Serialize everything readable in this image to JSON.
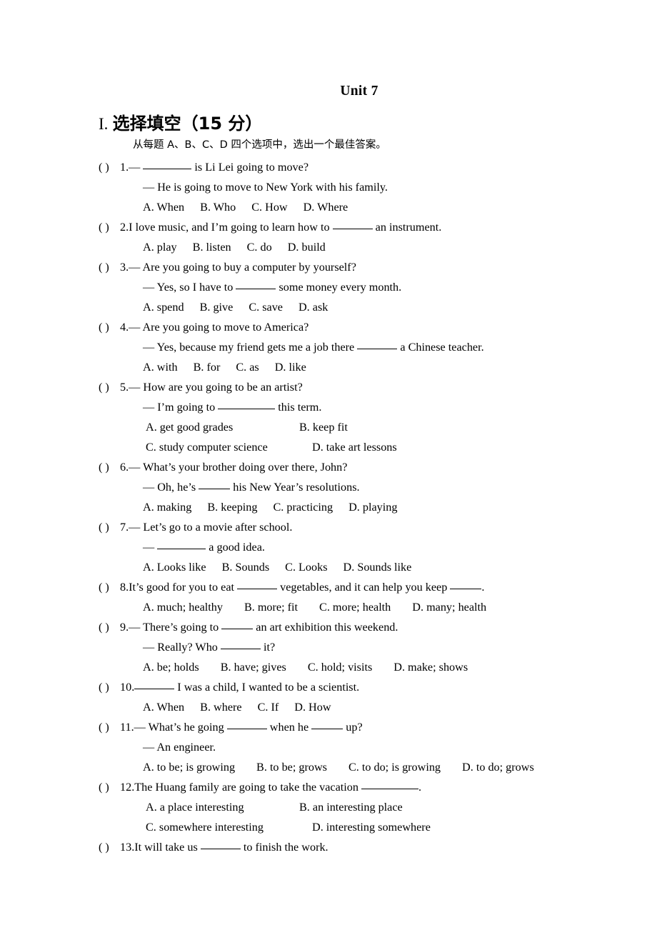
{
  "document": {
    "unit_title": "Unit 7",
    "section": {
      "roman": "I.",
      "title_cn": "选择填空（15 分）",
      "instruction": "从每题 A、B、C、D 四个选项中，选出一个最佳答案。"
    },
    "marker": "(    )",
    "questions": [
      {
        "num": "1.",
        "lines": [
          {
            "type": "prompt",
            "pre": "— ",
            "blank": "b6",
            "post": " is Li Lei going to move?"
          },
          {
            "type": "cont",
            "text": "— He is going to move to New York with his family."
          }
        ],
        "options_inline": [
          "A. When",
          "B. Who",
          "C. How",
          "D. Where"
        ],
        "options_layout": "inline"
      },
      {
        "num": "2.",
        "lines": [
          {
            "type": "prompt",
            "pre": "I love music, and I’m going to learn how to ",
            "blank": "b5",
            "post": " an instrument."
          }
        ],
        "options_inline": [
          "A. play",
          "B. listen",
          "C. do",
          "D. build"
        ],
        "options_layout": "inline"
      },
      {
        "num": "3.",
        "lines": [
          {
            "type": "prompt",
            "pre": "— Are you going to buy a computer by yourself?",
            "blank": "",
            "post": ""
          },
          {
            "type": "cont",
            "pre": "— Yes, so I have to ",
            "blank": "b5",
            "post": " some money every month."
          }
        ],
        "options_inline": [
          "A. spend",
          "B. give",
          "C. save",
          "D. ask"
        ],
        "options_layout": "inline"
      },
      {
        "num": "4.",
        "lines": [
          {
            "type": "prompt",
            "pre": "— Are you going to move to America?",
            "blank": "",
            "post": ""
          },
          {
            "type": "cont",
            "pre": "— Yes, because my friend gets me a job there ",
            "blank": "b5",
            "post": " a Chinese teacher."
          }
        ],
        "options_inline": [
          "A. with",
          "B. for",
          "C. as",
          "D. like"
        ],
        "options_layout": "inline"
      },
      {
        "num": "5.",
        "lines": [
          {
            "type": "prompt",
            "pre": "— How are you going to be an artist?",
            "blank": "",
            "post": ""
          },
          {
            "type": "cont",
            "pre": "— I’m going to ",
            "blank": "b7",
            "post": " this term."
          }
        ],
        "options_layout": "two-column",
        "options_grid": [
          [
            "A. get good grades",
            "B. keep fit"
          ],
          [
            "C. study computer science",
            "D. take art lessons"
          ]
        ]
      },
      {
        "num": "6.",
        "lines": [
          {
            "type": "prompt",
            "pre": "— What’s your brother doing over there, John?",
            "blank": "",
            "post": ""
          },
          {
            "type": "cont",
            "pre": "— Oh, he’s ",
            "blank": "b4",
            "post": " his New Year’s resolutions."
          }
        ],
        "options_inline": [
          "A. making",
          "B. keeping",
          "C. practicing",
          "D. playing"
        ],
        "options_layout": "inline"
      },
      {
        "num": "7.",
        "lines": [
          {
            "type": "prompt",
            "pre": "— Let’s go to a movie after school.",
            "blank": "",
            "post": ""
          },
          {
            "type": "cont",
            "pre": "— ",
            "blank": "b6",
            "post": " a good idea."
          }
        ],
        "options_inline": [
          "A. Looks like",
          "B. Sounds",
          "C. Looks",
          "D. Sounds like"
        ],
        "options_layout": "inline"
      },
      {
        "num": "8.",
        "lines": [
          {
            "type": "prompt",
            "pre": "It’s good for you to eat ",
            "blank": "b5",
            "post": " vegetables, and it can help you keep ",
            "blank2": "b4",
            "post2": "."
          }
        ],
        "options_inline": [
          "A. much; healthy",
          "B. more; fit",
          "C. more; health",
          "D. many; health"
        ],
        "options_layout": "inline"
      },
      {
        "num": "9.",
        "lines": [
          {
            "type": "prompt",
            "pre": "— There’s going to ",
            "blank": "b4",
            "post": " an art exhibition this weekend."
          },
          {
            "type": "cont",
            "pre": "— Really? Who ",
            "blank": "b5",
            "post": " it?"
          }
        ],
        "options_inline": [
          "A. be; holds",
          "B. have; gives",
          "C. hold; visits",
          "D. make; shows"
        ],
        "options_layout": "inline"
      },
      {
        "num": "10.",
        "lines": [
          {
            "type": "prompt",
            "pre": "",
            "blank": "b5",
            "post": " I was a child, I wanted to be a scientist."
          }
        ],
        "options_inline": [
          "A. When",
          "B. where",
          "C. If",
          "D. How"
        ],
        "options_layout": "inline"
      },
      {
        "num": "11.",
        "lines": [
          {
            "type": "prompt",
            "pre": "— What’s he going ",
            "blank": "b5",
            "post": " when he ",
            "blank2": "b4",
            "post2": " up?"
          },
          {
            "type": "cont",
            "text": "— An engineer."
          }
        ],
        "options_inline": [
          "A. to be; is growing",
          "B. to be; grows",
          "C. to do; is growing",
          "D. to do; grows"
        ],
        "options_layout": "inline"
      },
      {
        "num": "12.",
        "lines": [
          {
            "type": "prompt",
            "pre": "The Huang family are going to take the vacation ",
            "blank": "b7",
            "post": "."
          }
        ],
        "options_layout": "two-column",
        "options_grid": [
          [
            "A. a place interesting",
            "B. an interesting place"
          ],
          [
            "C. somewhere interesting",
            "D. interesting somewhere"
          ]
        ]
      },
      {
        "num": "13.",
        "lines": [
          {
            "type": "prompt",
            "pre": "It will take us ",
            "blank": "b5",
            "post": " to finish the work."
          }
        ],
        "options_layout": "none"
      }
    ]
  }
}
